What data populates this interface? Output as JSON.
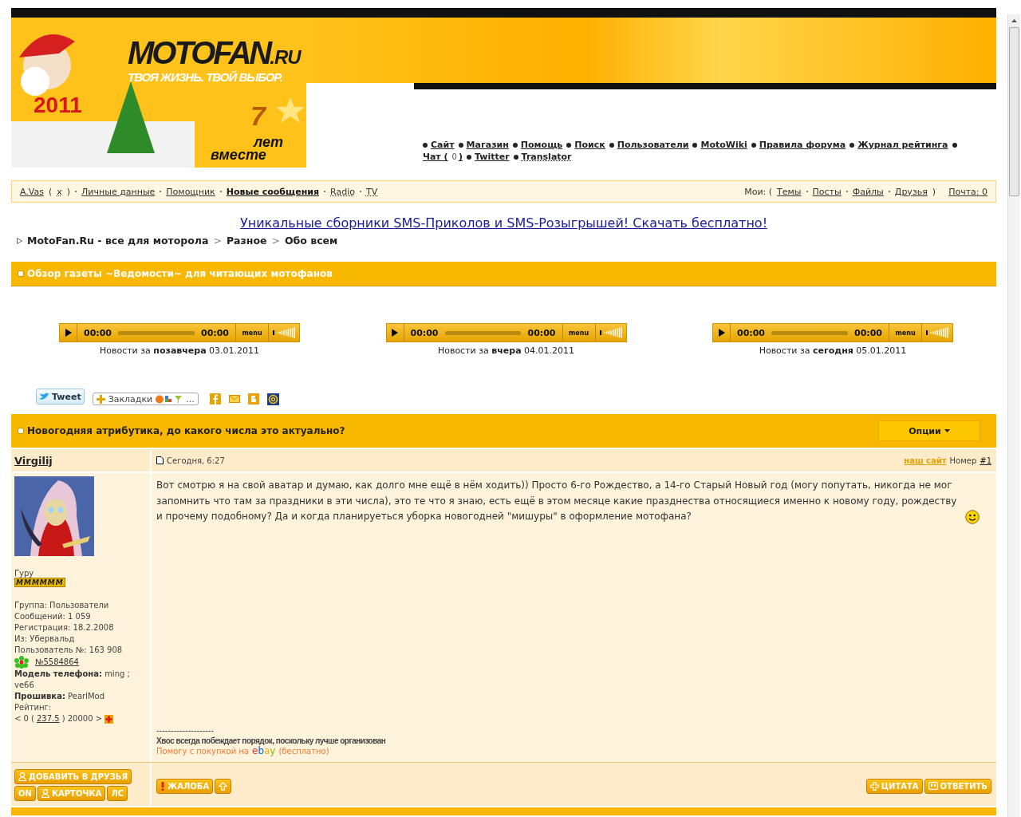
{
  "banner": {
    "logo_main": "MOTOFAN",
    "logo_suffix": ".RU",
    "slogan": "ТВОЯ ЖИЗНЬ. ТВОЙ ВЫБОР.",
    "year": "2011",
    "anniversary_number": "7",
    "anniversary_text_1": "лет",
    "anniversary_text_2": "вместе"
  },
  "nav_links": [
    {
      "kind": "link",
      "label": "Сайт"
    },
    {
      "kind": "link",
      "label": "Магазин"
    },
    {
      "kind": "link",
      "label": "Помощь"
    },
    {
      "kind": "link",
      "label": "Поиск"
    },
    {
      "kind": "link",
      "label": "Пользователи"
    },
    {
      "kind": "link",
      "label": "MotoWiki"
    },
    {
      "kind": "link",
      "label": "Правила форума"
    },
    {
      "kind": "link",
      "label": "Журнал рейтинга"
    },
    {
      "kind": "counter",
      "label": "Чат (",
      "count": "0",
      "suffix": ")"
    },
    {
      "kind": "link",
      "label": "Twitter"
    },
    {
      "kind": "dotted",
      "label": "Translator"
    }
  ],
  "user_bar": {
    "user": "A.Vas",
    "logout_open": "(",
    "logout": "x",
    "logout_close": ")",
    "links": [
      {
        "label": "Личные данные",
        "bold": false,
        "dotted": false
      },
      {
        "label": "Помощник",
        "bold": false,
        "dotted": false
      },
      {
        "label": "Новые сообщения",
        "bold": true,
        "dotted": false
      },
      {
        "label": "Radio",
        "bold": false,
        "dotted": true
      },
      {
        "label": "TV",
        "bold": false,
        "dotted": true
      }
    ],
    "mine_label": "Мои: (",
    "mine_links": [
      "Темы",
      "Посты",
      "Файлы",
      "Друзья"
    ],
    "mine_close": ")",
    "mail": "Почта: 0"
  },
  "ad_link": "Уникальные сборники SMS-Приколов и SMS-Розыгрышей! Скачать бесплатно!",
  "breadcrumbs": [
    "MotoFan.Ru - все для моторола",
    "Разное",
    "Обо всем"
  ],
  "breadcrumb_separator": ">",
  "section": {
    "title": "Обзор газеты ~Ведомости~ для читающих мотофанов"
  },
  "players": [
    {
      "time_elapsed": "00:00",
      "time_total": "00:00",
      "menu_label": "menu",
      "caption": "Новости за **позавчера** 03.01.2011"
    },
    {
      "time_elapsed": "00:00",
      "time_total": "00:00",
      "menu_label": "menu",
      "caption": "Новости за **вчера** 04.01.2011"
    },
    {
      "time_elapsed": "00:00",
      "time_total": "00:00",
      "menu_label": "menu",
      "caption": "Новости за **сегодня** 05.01.2011"
    }
  ],
  "share": {
    "tweet": "Tweet",
    "bookmarks": "Закладки",
    "bookmarks_more": "..."
  },
  "topic": {
    "title": "Новогодняя атрибутика, до какого числа это актуально?",
    "options_button": "Опции"
  },
  "post": {
    "author": "Virgilij",
    "date": "Сегодня, 6:27",
    "site_link": "наш сайт",
    "number_label": "Номер",
    "number": "#1",
    "rank": "Гуру",
    "rank_pips": "MMMMMM",
    "details": [
      {
        "kind": "text",
        "text": "Группа: Пользователи"
      },
      {
        "kind": "text",
        "text": "Сообщений: 1 059"
      },
      {
        "kind": "text",
        "text": "Регистрация: 18.2.2008"
      },
      {
        "kind": "text",
        "text": "Из: Убервальд"
      },
      {
        "kind": "text",
        "text": "Пользователь №: 163 908"
      },
      {
        "kind": "icq",
        "text": "№5584864"
      },
      {
        "kind": "text",
        "text": "**Модель телефона:** ming ; ve66"
      },
      {
        "kind": "text",
        "text": "**Прошивка:** PearlMod"
      },
      {
        "kind": "text",
        "text": "Рейтинг:"
      }
    ],
    "rating": {
      "prefix": "< 0 (",
      "value": "237.5",
      "suffix": ") 20000 >"
    },
    "body": "Вот смотрю я на свой аватар и думаю, как долго мне ещё в нём ходить)) Просто 6-го Рождество, а 14-го Старый Новый год (могу попутать, никогда не мог запомнить что там за праздники в эти числа), это те что я знаю, есть ещё в этом месяце какие празднества относящиеся именно к новому году, рождеству и прочему подобному? Да и когда планируеться уборка новогодней \"мишуры\" в оформление мотофана?",
    "signature": {
      "rule": "--------------------",
      "motto": "Хвос всегда побеждает порядок, поскольку лучше организован",
      "offer": "Помогу с покупкой на",
      "brand": "ebay",
      "offer_note": "(бесплатно)"
    },
    "left_buttons": [
      {
        "kind": "person",
        "label": "ДОБАВИТЬ В ДРУЗЬЯ"
      },
      {
        "kind": "plain",
        "label": "ON"
      },
      {
        "kind": "person",
        "label": "КАРТОЧКА"
      },
      {
        "kind": "plain",
        "label": "ЛС"
      }
    ],
    "middle_buttons": [
      {
        "kind": "alert",
        "label": "ЖАЛОБА"
      },
      {
        "kind": "up"
      }
    ],
    "right_buttons": [
      {
        "kind": "plus",
        "label": "ЦИТАТА"
      },
      {
        "kind": "quote",
        "label": "ОТВЕТИТЬ"
      }
    ]
  }
}
